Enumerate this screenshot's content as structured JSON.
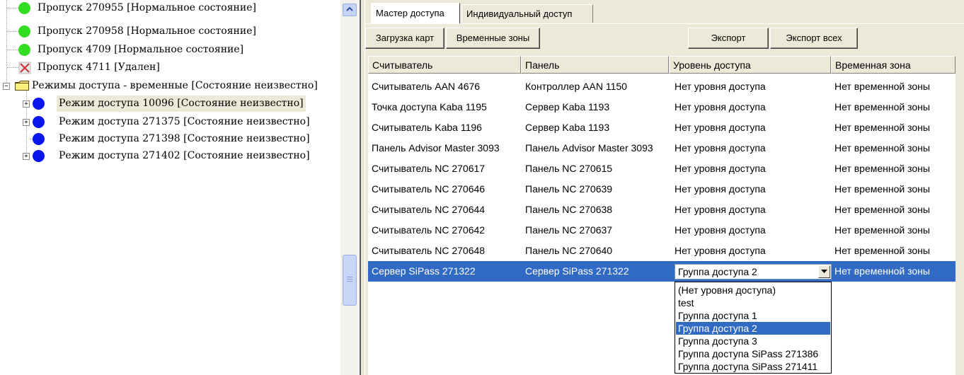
{
  "tree": {
    "items": [
      {
        "label": "Пропуск 270955 [Нормальное состояние]",
        "icon": "green-status-icon"
      },
      {
        "label": "Пропуск 270958 [Нормальное состояние]",
        "icon": "green-status-icon"
      },
      {
        "label": "Пропуск 4709 [Нормальное состояние]",
        "icon": "green-status-icon"
      },
      {
        "label": "Пропуск 4711 [Удален]",
        "icon": "deleted-x-icon"
      },
      {
        "label": "Режимы доступа - временные [Состояние неизвестно]",
        "icon": "folder-icon"
      },
      {
        "label": "Режим доступа 10096 [Состояние неизвестно]",
        "icon": "blue-status-icon"
      },
      {
        "label": "Режим доступа 271375 [Состояние неизвестно]",
        "icon": "blue-status-icon"
      },
      {
        "label": "Режим доступа 271398 [Состояние неизвестно]",
        "icon": "blue-status-icon"
      },
      {
        "label": "Режим доступа 271402 [Состояние неизвестно]",
        "icon": "blue-status-icon"
      }
    ]
  },
  "tabs": [
    "Мастер доступа",
    "Индивидуальный доступ"
  ],
  "toolbar": {
    "load_cards": "Загрузка карт",
    "time_zones": "Временные зоны",
    "export": "Экспорт",
    "export_all": "Экспорт всех"
  },
  "grid": {
    "columns": [
      "Считыватель",
      "Панель",
      "Уровень доступа",
      "Временная зона"
    ],
    "rows": [
      [
        "Считыватель AAN 4676",
        "Контроллер AAN 1150",
        "Нет уровня доступа",
        "Нет временной зоны"
      ],
      [
        "Точка доступа Kaba 1195",
        "Сервер Kaba 1193",
        "Нет уровня доступа",
        "Нет временной зоны"
      ],
      [
        "Считыватель Kaba 1196",
        "Сервер Kaba 1193",
        "Нет уровня доступа",
        "Нет временной зоны"
      ],
      [
        "Панель Advisor Master 3093",
        "Панель Advisor Master 3093",
        "Нет уровня доступа",
        "Нет временной зоны"
      ],
      [
        "Считыватель NC 270617",
        "Панель NC 270615",
        "Нет уровня доступа",
        "Нет временной зоны"
      ],
      [
        "Считыватель NC 270646",
        "Панель NC 270639",
        "Нет уровня доступа",
        "Нет временной зоны"
      ],
      [
        "Считыватель NC 270644",
        "Панель NC 270638",
        "Нет уровня доступа",
        "Нет временной зоны"
      ],
      [
        "Считыватель NC 270642",
        "Панель NC 270637",
        "Нет уровня доступа",
        "Нет временной зоны"
      ],
      [
        "Считыватель NC 270648",
        "Панель NC 270640",
        "Нет уровня доступа",
        "Нет временной зоны"
      ],
      [
        "Сервер SiPass 271322",
        "Сервер SiPass 271322",
        "Группа доступа 2",
        "Нет временной зоны"
      ]
    ]
  },
  "combo": {
    "value": "Группа доступа 2",
    "options": [
      "(Нет уровня доступа)",
      "test",
      "Группа доступа 1",
      "Группа доступа 2",
      "Группа доступа 3",
      "Группа доступа SiPass 271386",
      "Группа доступа SiPass 271411"
    ]
  },
  "colors": {
    "selection": "#316ac5",
    "status_green": "#33dd22",
    "status_blue": "#0a16f0",
    "panel_bg": "#ece9d8"
  }
}
